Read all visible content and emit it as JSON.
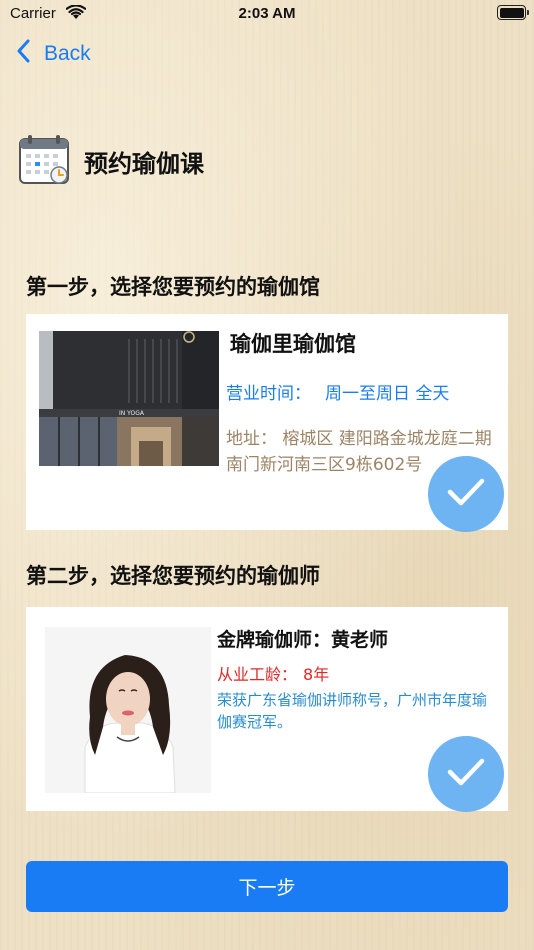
{
  "status_bar": {
    "carrier": "Carrier",
    "time": "2:03 AM"
  },
  "nav": {
    "back_label": "Back"
  },
  "page": {
    "title": "预约瑜伽课"
  },
  "step1": {
    "heading": "第一步，选择您要预约的瑜伽馆",
    "venue": {
      "name": "瑜伽里瑜伽馆",
      "hours_label": "营业时间：",
      "hours_value": "周一至周日 全天",
      "address": "地址：  榕城区 建阳路金城龙庭二期南门新河南三区9栋602号",
      "photo_sign_text": "IN YOGA",
      "selected": true
    }
  },
  "step2": {
    "heading": "第二步，选择您要预约的瑜伽师",
    "teacher": {
      "name": "金牌瑜伽师：黄老师",
      "experience_label": "从业工龄：",
      "experience_value": "8年",
      "description": "荣获广东省瑜伽讲师称号，广州市年度瑜伽赛冠军。",
      "selected": true
    }
  },
  "actions": {
    "next_label": "下一步"
  },
  "colors": {
    "accent": "#1a7cf5",
    "badge": "#5aaaf0",
    "address": "#9d8466",
    "experience": "#e02727",
    "description": "#2a8cd0"
  },
  "icons": {
    "wifi": "wifi-icon",
    "battery": "battery-icon",
    "back": "chevron-left-icon",
    "calendar": "calendar-icon",
    "check": "checkmark-icon"
  }
}
